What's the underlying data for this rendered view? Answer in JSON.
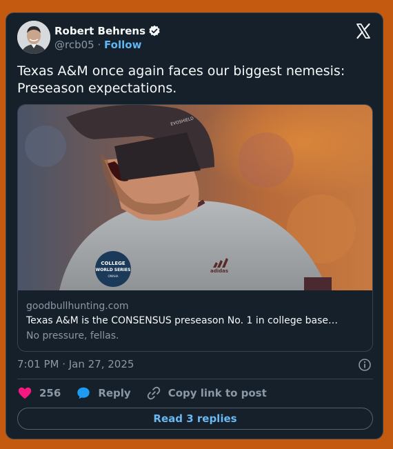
{
  "author": {
    "name": "Robert Behrens",
    "handle": "@rcb05",
    "separator": "·",
    "follow_label": "Follow"
  },
  "tweet": {
    "text": "Texas A&M once again faces our biggest nemesis: Preseason expectations."
  },
  "link_card": {
    "domain": "goodbullhunting.com",
    "title": "Texas A&M is the CONSENSUS preseason No. 1 in college base…",
    "description": "No pressure, fellas.",
    "image_texts": {
      "helmet_brand": "EVOSHIELD",
      "patch_line1": "COLLEGE",
      "patch_line2": "WORLD SERIES",
      "patch_line3": "OMAHA",
      "jersey_brand": "adidas"
    }
  },
  "timestamp": "7:01 PM · Jan 27, 2025",
  "actions": {
    "likes": "256",
    "reply_label": "Reply",
    "copy_link_label": "Copy link to post"
  },
  "read_replies_label": "Read 3 replies",
  "colors": {
    "page_background": "#c45a10",
    "card_background": "#15202b",
    "accent_blue": "#1d9bf0",
    "like_pink": "#f91880"
  },
  "icons": [
    "verified-badge-icon",
    "x-logo-icon",
    "info-icon",
    "heart-icon",
    "reply-bubble-icon",
    "link-icon"
  ]
}
